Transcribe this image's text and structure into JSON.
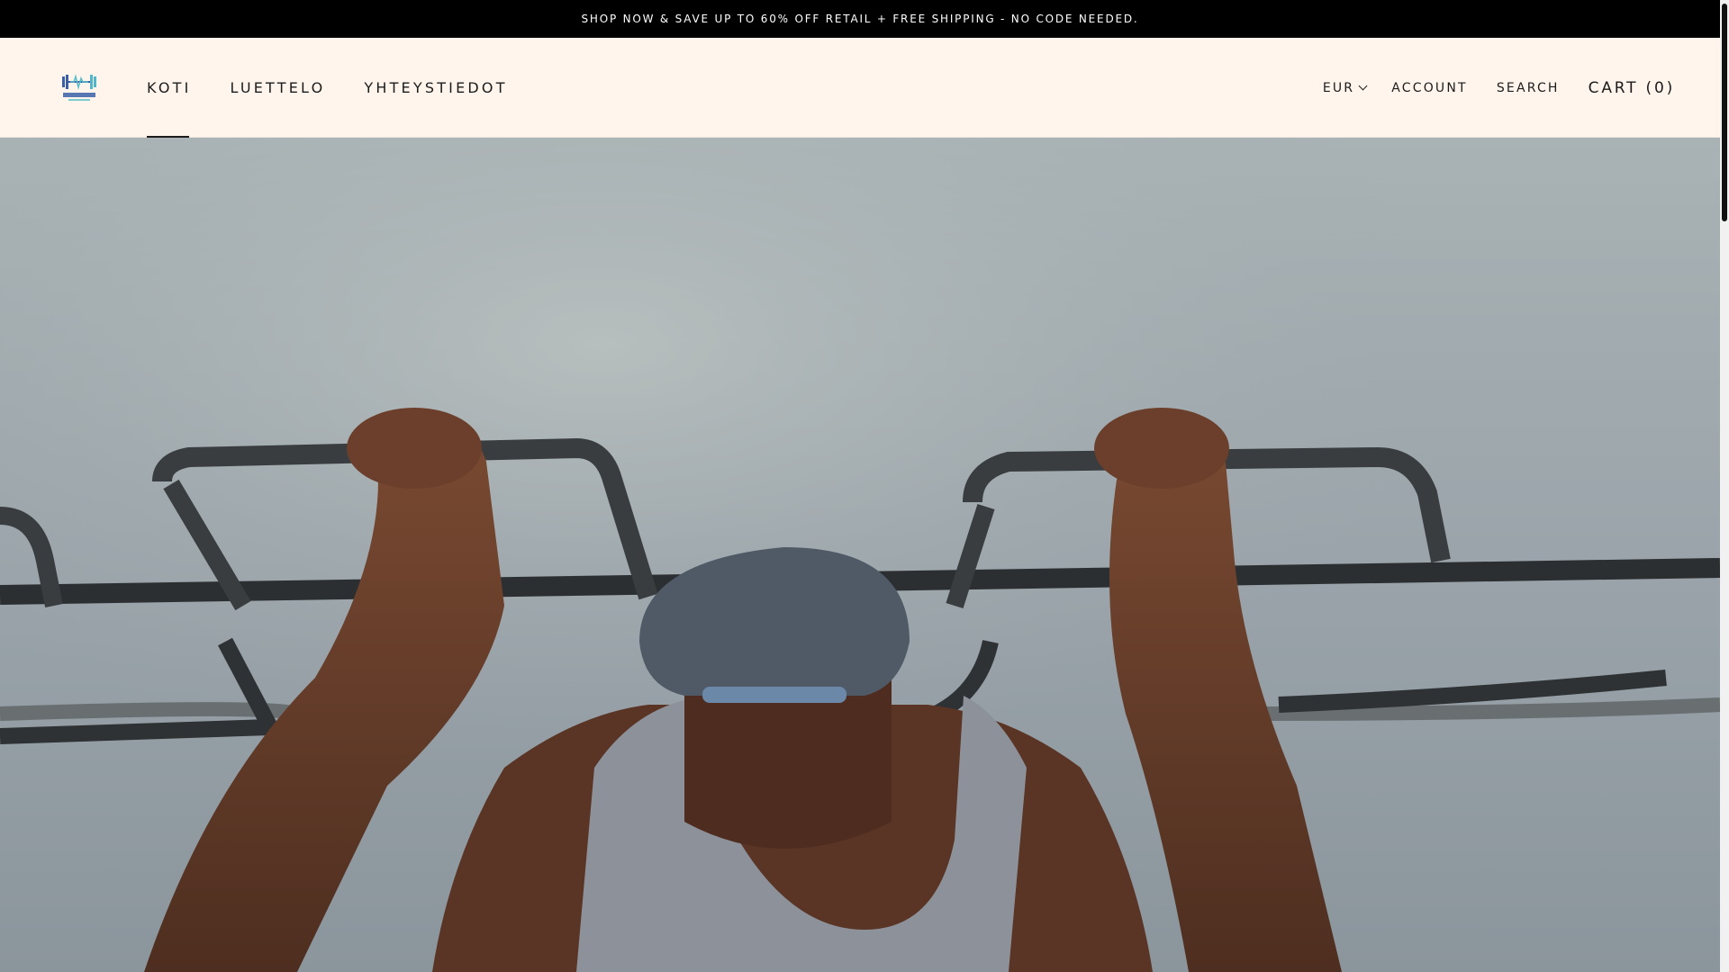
{
  "announcement": {
    "text": "SHOP NOW & SAVE UP TO 60% OFF RETAIL + FREE SHIPPING - NO CODE NEEDED."
  },
  "header": {
    "logo_icon": "pulse-fitness-logo-icon",
    "nav": [
      {
        "label": "KOTI",
        "active": true
      },
      {
        "label": "LUETTELO",
        "active": false
      },
      {
        "label": "YHTEYSTIEDOT",
        "active": false
      }
    ],
    "currency": "EUR",
    "account_label": "ACCOUNT",
    "search_label": "SEARCH",
    "cart_label": "CART (0)"
  },
  "hero": {
    "image_icon": "hero-image-pullup-bars"
  },
  "colors": {
    "announcement_bg": "#000000",
    "header_bg": "#fff5ec",
    "text": "#1c1b1b",
    "sky": "#a6b0b3"
  }
}
